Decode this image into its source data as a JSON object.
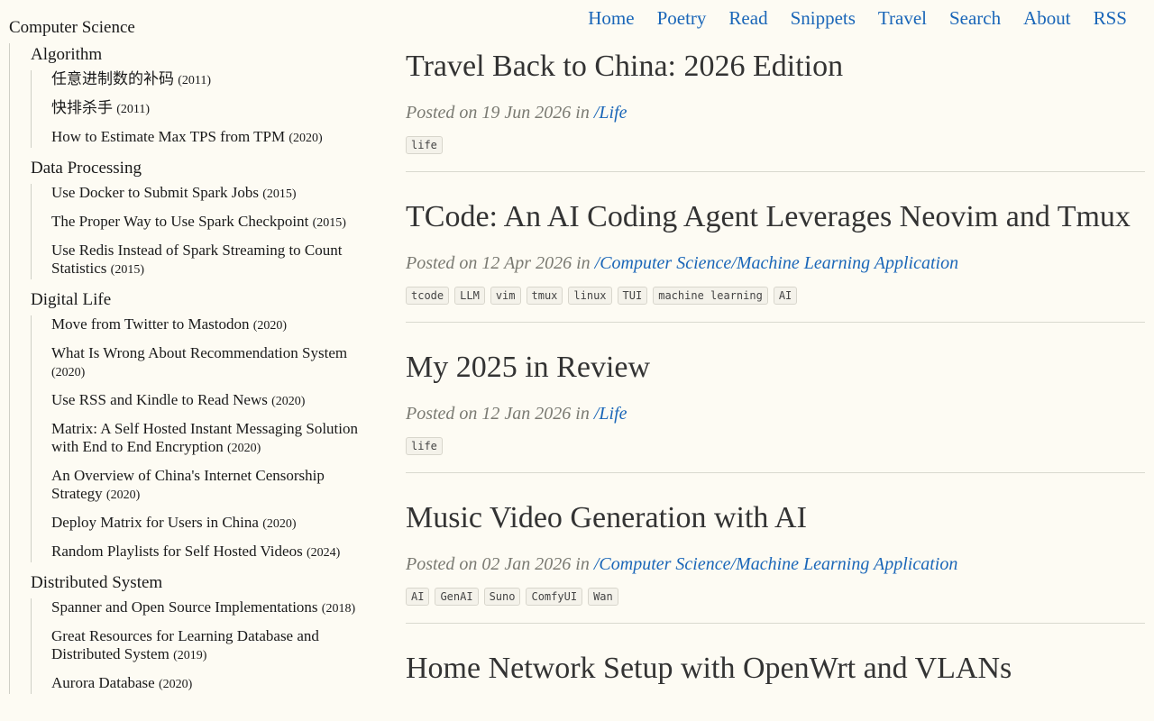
{
  "nav": {
    "items": [
      "Home",
      "Poetry",
      "Read",
      "Snippets",
      "Travel",
      "Search",
      "About",
      "RSS"
    ]
  },
  "sidebar": {
    "root": "Computer Science",
    "sections": [
      {
        "name": "Algorithm",
        "items": [
          {
            "title": "任意进制数的补码",
            "year": "(2011)"
          },
          {
            "title": "快排杀手",
            "year": "(2011)"
          },
          {
            "title": "How to Estimate Max TPS from TPM",
            "year": "(2020)"
          }
        ]
      },
      {
        "name": "Data Processing",
        "items": [
          {
            "title": "Use Docker to Submit Spark Jobs",
            "year": "(2015)"
          },
          {
            "title": "The Proper Way to Use Spark Checkpoint",
            "year": "(2015)"
          },
          {
            "title": "Use Redis Instead of Spark Streaming to Count Statistics",
            "year": "(2015)"
          }
        ]
      },
      {
        "name": "Digital Life",
        "items": [
          {
            "title": "Move from Twitter to Mastodon",
            "year": "(2020)"
          },
          {
            "title": "What Is Wrong About Recommendation System",
            "year": "(2020)"
          },
          {
            "title": "Use RSS and Kindle to Read News",
            "year": "(2020)"
          },
          {
            "title": "Matrix: A Self Hosted Instant Messaging Solution with End to End Encryption",
            "year": "(2020)"
          },
          {
            "title": "An Overview of China's Internet Censorship Strategy",
            "year": "(2020)"
          },
          {
            "title": "Deploy Matrix for Users in China",
            "year": "(2020)"
          },
          {
            "title": "Random Playlists for Self Hosted Videos",
            "year": "(2024)"
          }
        ]
      },
      {
        "name": "Distributed System",
        "items": [
          {
            "title": "Spanner and Open Source Implementations",
            "year": "(2018)"
          },
          {
            "title": "Great Resources for Learning Database and Distributed System",
            "year": "(2019)"
          },
          {
            "title": "Aurora Database",
            "year": "(2020)"
          }
        ]
      }
    ]
  },
  "posts": [
    {
      "title": "Travel Back to China: 2026 Edition",
      "posted_prefix": "Posted on 19 Jun 2026 in",
      "category": "/Life",
      "tags": [
        "life"
      ]
    },
    {
      "title": "TCode: An AI Coding Agent Leverages Neovim and Tmux",
      "posted_prefix": "Posted on 12 Apr 2026 in",
      "category": "/Computer Science/Machine Learning Application",
      "tags": [
        "tcode",
        "LLM",
        "vim",
        "tmux",
        "linux",
        "TUI",
        "machine learning",
        "AI"
      ]
    },
    {
      "title": "My 2025 in Review",
      "posted_prefix": "Posted on 12 Jan 2026 in",
      "category": "/Life",
      "tags": [
        "life"
      ]
    },
    {
      "title": "Music Video Generation with AI",
      "posted_prefix": "Posted on 02 Jan 2026 in",
      "category": "/Computer Science/Machine Learning Application",
      "tags": [
        "AI",
        "GenAI",
        "Suno",
        "ComfyUI",
        "Wan"
      ]
    },
    {
      "title": "Home Network Setup with OpenWrt and VLANs",
      "posted_prefix": "",
      "category": "",
      "tags": []
    }
  ]
}
